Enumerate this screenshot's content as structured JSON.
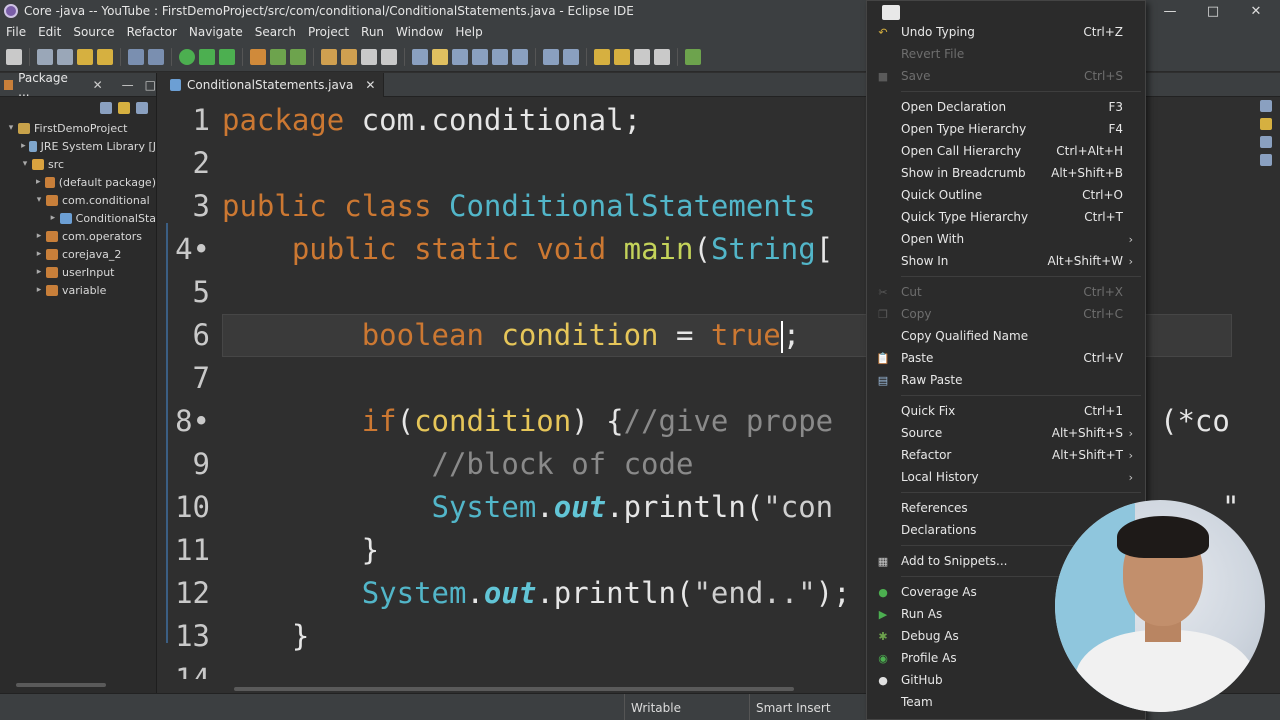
{
  "window": {
    "title": "Core -java -- YouTube : FirstDemoProject/src/com/conditional/ConditionalStatements.java - Eclipse IDE"
  },
  "menubar": [
    "File",
    "Edit",
    "Source",
    "Refactor",
    "Navigate",
    "Search",
    "Project",
    "Run",
    "Window",
    "Help"
  ],
  "package_explorer": {
    "tab_label": "Package ...",
    "tree": [
      {
        "label": "FirstDemoProject",
        "indent": 0,
        "twisty": "▾",
        "icon": "project-icon"
      },
      {
        "label": "JRE System Library [J",
        "indent": 1,
        "twisty": "▸",
        "icon": "library-icon"
      },
      {
        "label": "src",
        "indent": 1,
        "twisty": "▾",
        "icon": "source-folder-icon"
      },
      {
        "label": "(default package)",
        "indent": 2,
        "twisty": "▸",
        "icon": "package-icon"
      },
      {
        "label": "com.conditional",
        "indent": 2,
        "twisty": "▾",
        "icon": "package-icon"
      },
      {
        "label": "ConditionalSta",
        "indent": 3,
        "twisty": "▸",
        "icon": "java-file-icon"
      },
      {
        "label": "com.operators",
        "indent": 2,
        "twisty": "▸",
        "icon": "package-icon"
      },
      {
        "label": "corejava_2",
        "indent": 2,
        "twisty": "▸",
        "icon": "package-icon"
      },
      {
        "label": "userInput",
        "indent": 2,
        "twisty": "▸",
        "icon": "package-icon"
      },
      {
        "label": "variable",
        "indent": 2,
        "twisty": "▸",
        "icon": "package-icon"
      }
    ]
  },
  "editor": {
    "tab_label": "ConditionalStatements.java",
    "lines": [
      {
        "n": "1",
        "code": "package com.conditional;"
      },
      {
        "n": "2",
        "code": ""
      },
      {
        "n": "3",
        "code": "public class ConditionalStatements"
      },
      {
        "n": "4•",
        "code": "    public static void main(String["
      },
      {
        "n": "5",
        "code": ""
      },
      {
        "n": "6",
        "code": "        boolean condition = true;"
      },
      {
        "n": "7",
        "code": ""
      },
      {
        "n": "8•",
        "code": "        if(condition) {//give prope"
      },
      {
        "n": "9",
        "code": "            //block of code"
      },
      {
        "n": "10",
        "code": "            System.out.println(\"con"
      },
      {
        "n": "11",
        "code": "        }"
      },
      {
        "n": "12",
        "code": "        System.out.println(\"end..\");"
      },
      {
        "n": "13",
        "code": "    }"
      },
      {
        "n": "14",
        "code": ""
      }
    ],
    "right_fragment_line8": "(*co",
    "right_fragment_line10": "\""
  },
  "status": {
    "writable": "Writable",
    "insert_mode": "Smart Insert"
  },
  "context_menu": {
    "items": [
      {
        "label": "Undo Typing",
        "shortcut": "Ctrl+Z",
        "icon": "undo-icon",
        "disabled": false
      },
      {
        "label": "Revert File",
        "shortcut": "",
        "icon": "",
        "disabled": true
      },
      {
        "label": "Save",
        "shortcut": "Ctrl+S",
        "icon": "save-icon",
        "disabled": true
      },
      {
        "sep": true
      },
      {
        "label": "Open Declaration",
        "shortcut": "F3",
        "disabled": false
      },
      {
        "label": "Open Type Hierarchy",
        "shortcut": "F4",
        "disabled": false
      },
      {
        "label": "Open Call Hierarchy",
        "shortcut": "Ctrl+Alt+H",
        "disabled": false
      },
      {
        "label": "Show in Breadcrumb",
        "shortcut": "Alt+Shift+B",
        "disabled": false
      },
      {
        "label": "Quick Outline",
        "shortcut": "Ctrl+O",
        "disabled": false
      },
      {
        "label": "Quick Type Hierarchy",
        "shortcut": "Ctrl+T",
        "disabled": false
      },
      {
        "label": "Open With",
        "shortcut": "",
        "submenu": true,
        "disabled": false
      },
      {
        "label": "Show In",
        "shortcut": "Alt+Shift+W",
        "submenu": true,
        "disabled": false
      },
      {
        "sep": true
      },
      {
        "label": "Cut",
        "shortcut": "Ctrl+X",
        "icon": "cut-icon",
        "disabled": true
      },
      {
        "label": "Copy",
        "shortcut": "Ctrl+C",
        "icon": "copy-icon",
        "disabled": true
      },
      {
        "label": "Copy Qualified Name",
        "shortcut": "",
        "disabled": false
      },
      {
        "label": "Paste",
        "shortcut": "Ctrl+V",
        "icon": "paste-icon",
        "disabled": false
      },
      {
        "label": "Raw Paste",
        "shortcut": "",
        "icon": "raw-paste-icon",
        "disabled": false
      },
      {
        "sep": true
      },
      {
        "label": "Quick Fix",
        "shortcut": "Ctrl+1",
        "disabled": false
      },
      {
        "label": "Source",
        "shortcut": "Alt+Shift+S",
        "submenu": true,
        "disabled": false
      },
      {
        "label": "Refactor",
        "shortcut": "Alt+Shift+T",
        "submenu": true,
        "disabled": false
      },
      {
        "label": "Local History",
        "shortcut": "",
        "submenu": true,
        "disabled": false
      },
      {
        "sep": true
      },
      {
        "label": "References",
        "shortcut": "",
        "disabled": false
      },
      {
        "label": "Declarations",
        "shortcut": "",
        "disabled": false
      },
      {
        "sep": true
      },
      {
        "label": "Add to Snippets...",
        "shortcut": "",
        "icon": "snippets-icon",
        "disabled": false
      },
      {
        "sep": true
      },
      {
        "label": "Coverage As",
        "shortcut": "",
        "icon": "coverage-icon",
        "disabled": false
      },
      {
        "label": "Run As",
        "shortcut": "",
        "icon": "run-icon",
        "disabled": false
      },
      {
        "label": "Debug As",
        "shortcut": "",
        "icon": "debug-icon",
        "disabled": false
      },
      {
        "label": "Profile As",
        "shortcut": "",
        "icon": "profile-icon",
        "disabled": false
      },
      {
        "label": "GitHub",
        "shortcut": "",
        "icon": "github-icon",
        "disabled": false
      },
      {
        "label": "Team",
        "shortcut": "",
        "disabled": false
      }
    ]
  },
  "colors": {
    "menu_bg": "#2b2b2b",
    "editor_bg": "#2f2f2f",
    "keyword": "#cc7832",
    "type": "#52b6c9",
    "method": "#c4d35a",
    "variable": "#e6c659"
  }
}
